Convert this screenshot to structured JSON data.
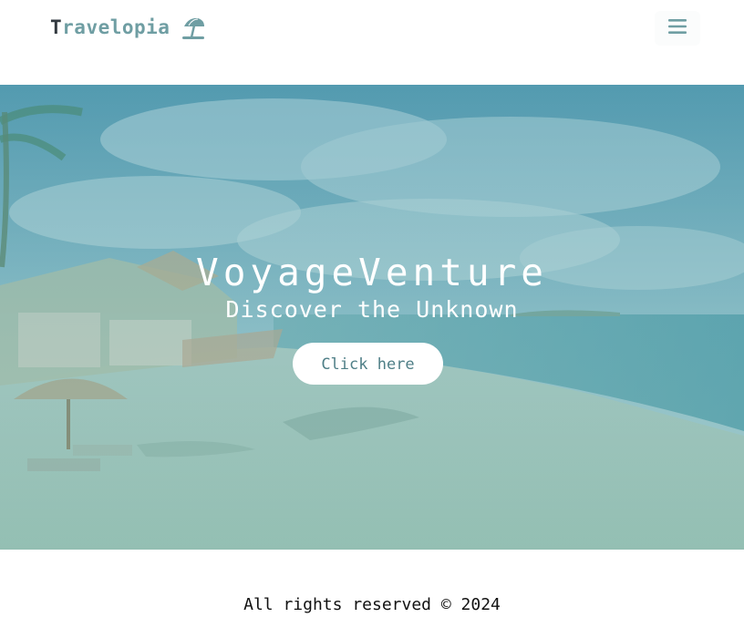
{
  "navbar": {
    "brand_first": "T",
    "brand_rest": "ravelopia",
    "brand_icon": "beach-umbrella-icon",
    "menu_icon": "hamburger-menu-icon"
  },
  "hero": {
    "title": "VoyageVenture",
    "subtitle": "Discover the Unknown",
    "button_label": "Click here",
    "background": "beach-resort-photo"
  },
  "footer": {
    "text": "All rights reserved © 2024"
  },
  "colors": {
    "accent": "#6f9ea3",
    "brand_dark": "#333a40",
    "button_text": "#4f7f87"
  }
}
